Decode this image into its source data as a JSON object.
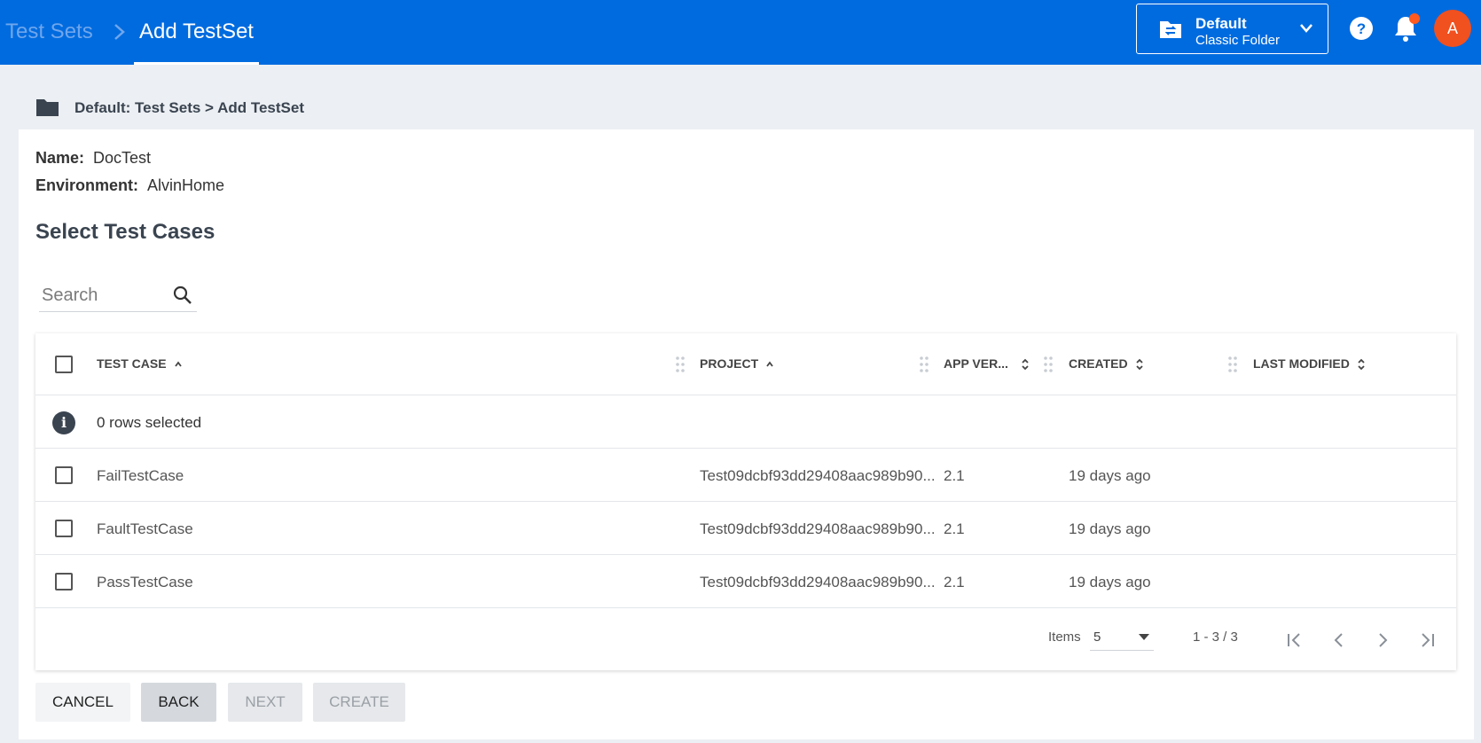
{
  "header": {
    "breadcrumb_parent": "Test Sets",
    "breadcrumb_current": "Add TestSet",
    "folder_switcher": {
      "title": "Default",
      "subtitle": "Classic Folder"
    },
    "avatar_initial": "A",
    "notification_dot": true
  },
  "page_breadcrumb": "Default: Test Sets > Add TestSet",
  "form": {
    "name_label": "Name:",
    "name_value": "DocTest",
    "environment_label": "Environment:",
    "environment_value": "AlvinHome"
  },
  "section_title": "Select Test Cases",
  "search": {
    "placeholder": "Search"
  },
  "table": {
    "columns": [
      {
        "label": "TEST CASE",
        "sort": "asc"
      },
      {
        "label": "PROJECT",
        "sort": "asc"
      },
      {
        "label": "APP VER...",
        "sort": "none"
      },
      {
        "label": "CREATED",
        "sort": "none"
      },
      {
        "label": "LAST MODIFIED",
        "sort": "none"
      }
    ],
    "selection_info": "0 rows selected",
    "rows": [
      {
        "test_case": "FailTestCase",
        "project": "Test09dcbf93dd29408aac989b90...",
        "app_version": "2.1",
        "created": "19 days ago",
        "last_modified": ""
      },
      {
        "test_case": "FaultTestCase",
        "project": "Test09dcbf93dd29408aac989b90...",
        "app_version": "2.1",
        "created": "19 days ago",
        "last_modified": ""
      },
      {
        "test_case": "PassTestCase",
        "project": "Test09dcbf93dd29408aac989b90...",
        "app_version": "2.1",
        "created": "19 days ago",
        "last_modified": ""
      }
    ]
  },
  "pager": {
    "items_label": "Items",
    "items_value": "5",
    "range": "1 - 3 / 3"
  },
  "buttons": {
    "cancel": "CANCEL",
    "back": "BACK",
    "next": "NEXT",
    "create": "CREATE"
  },
  "colors": {
    "header_bg": "#006bdf",
    "avatar_bg": "#f1501f",
    "notification_dot": "#ff5a1f",
    "page_bg": "#eceff3"
  }
}
